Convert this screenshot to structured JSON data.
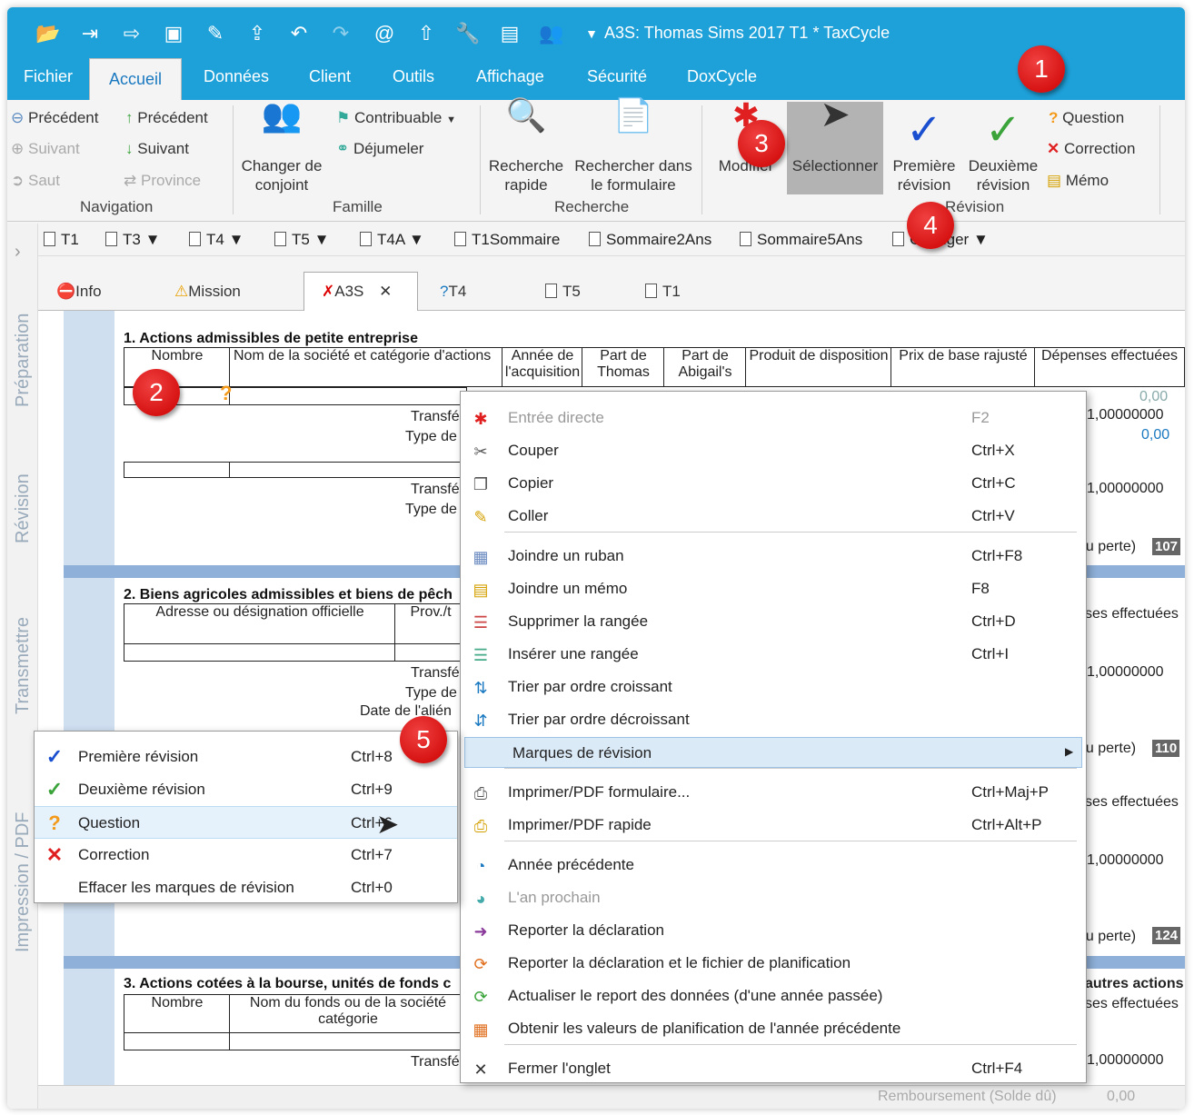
{
  "app": {
    "title": "A3S: Thomas Sims 2017 T1 * TaxCycle"
  },
  "ribbon_tabs": [
    "Fichier",
    "Accueil",
    "Données",
    "Client",
    "Outils",
    "Affichage",
    "Sécurité",
    "DoxCycle"
  ],
  "navigation": {
    "col1": [
      "Précédent",
      "Suivant",
      "Saut"
    ],
    "col2": [
      "Précédent",
      "Suivant",
      "Province"
    ],
    "group": "Navigation"
  },
  "famille": {
    "changer": "Changer de\nconjoint",
    "contribuable": "Contribuable",
    "dejumeler": "Déjumeler",
    "group": "Famille"
  },
  "recherche": {
    "rapide": "Recherche\nrapide",
    "formulaire": "Rechercher dans\nle formulaire",
    "group": "Recherche"
  },
  "revision": {
    "modifier": "Modifier",
    "selectionner": "Sélectionner",
    "premiere": "Première\nrévision",
    "deuxieme": "Deuxième\nrévision",
    "group": "Révision",
    "question": "Question",
    "correction": "Correction",
    "memo": "Mémo"
  },
  "formbar": [
    "T1",
    "T3",
    "T4",
    "T5",
    "T4A",
    "T1Sommaire",
    "Sommaire2Ans",
    "Sommaire5Ans",
    "Changer"
  ],
  "left_panels": [
    "Préparation",
    "Révision",
    "Transmettre",
    "Impression / PDF"
  ],
  "doc_tabs": [
    "Info",
    "Mission",
    "A3S",
    "T4",
    "T5",
    "T1"
  ],
  "form": {
    "s1": "1. Actions admissibles de petite entreprise",
    "s1_cols": [
      "Nombre",
      "Nom de la société et catégorie d'actions",
      "Année de l'acquisition",
      "Part de Thomas",
      "Part de Abigail's",
      "Produit de disposition",
      "Prix de base rajusté",
      "Dépenses effectuées"
    ],
    "transfer": "Transfé",
    "type": "Type de",
    "date_alien": "Date de l'alién",
    "v_zero": "0,00",
    "v_ratio": "1,00000000",
    "perte": "ou perte)",
    "n107": "107",
    "n110": "110",
    "n124": "124",
    "s2": "2. Biens agricoles admissibles et biens de pêch",
    "s2_cols": [
      "Adresse ou désignation officielle",
      "Prov./t"
    ],
    "s2_dep": "ses effectuées",
    "s3": "3. Actions cotées à la bourse, unités de fonds c",
    "s3_cols": [
      "Nombre",
      "Nom du fonds ou de la société catégorie"
    ],
    "s3_right": "autres actions",
    "status_label": "Remboursement (Solde dû)",
    "status_value": "0,00"
  },
  "context_menu": [
    {
      "label": "Entrée directe",
      "key": "F2",
      "disabled": true,
      "icon": "asterisk-icon"
    },
    {
      "label": "Couper",
      "key": "Ctrl+X",
      "icon": "scissors-icon"
    },
    {
      "label": "Copier",
      "key": "Ctrl+C",
      "icon": "copy-icon"
    },
    {
      "label": "Coller",
      "key": "Ctrl+V",
      "icon": "paste-icon"
    },
    {
      "label": "Joindre un ruban",
      "key": "Ctrl+F8",
      "icon": "tape-icon"
    },
    {
      "label": "Joindre un mémo",
      "key": "F8",
      "icon": "memo-icon"
    },
    {
      "label": "Supprimer la rangée",
      "key": "Ctrl+D",
      "icon": "delete-row-icon"
    },
    {
      "label": "Insérer une rangée",
      "key": "Ctrl+I",
      "icon": "insert-row-icon"
    },
    {
      "label": "Trier par ordre croissant",
      "key": "",
      "icon": "sort-asc-icon"
    },
    {
      "label": "Trier par ordre décroissant",
      "key": "",
      "icon": "sort-desc-icon"
    },
    {
      "label": "Marques de révision",
      "key": "",
      "icon": "",
      "submenu": true
    },
    {
      "label": "Imprimer/PDF formulaire...",
      "key": "Ctrl+Maj+P",
      "icon": "print-icon"
    },
    {
      "label": "Imprimer/PDF rapide",
      "key": "Ctrl+Alt+P",
      "icon": "quick-print-icon"
    },
    {
      "label": "Année précédente",
      "key": "",
      "icon": "prev-year-icon"
    },
    {
      "label": "L'an prochain",
      "key": "",
      "disabled": true,
      "icon": "next-year-icon"
    },
    {
      "label": "Reporter la déclaration",
      "key": "",
      "icon": "carry-forward-icon"
    },
    {
      "label": "Reporter la déclaration et le fichier de planification",
      "key": "",
      "icon": "carry-plan-icon"
    },
    {
      "label": "Actualiser le report des données (d'une année passée)",
      "key": "",
      "icon": "refresh-icon"
    },
    {
      "label": "Obtenir les valeurs de planification de l'année précédente",
      "key": "",
      "icon": "calendar-icon"
    },
    {
      "label": "Fermer l'onglet",
      "key": "Ctrl+F4",
      "icon": "close-icon"
    }
  ],
  "submenu": [
    {
      "label": "Première révision",
      "key": "Ctrl+8",
      "icon": "blue-check-icon"
    },
    {
      "label": "Deuxième révision",
      "key": "Ctrl+9",
      "icon": "green-check-icon"
    },
    {
      "label": "Question",
      "key": "Ctrl+6",
      "icon": "question-icon"
    },
    {
      "label": "Correction",
      "key": "Ctrl+7",
      "icon": "red-x-icon"
    },
    {
      "label": "Effacer les marques de révision",
      "key": "Ctrl+0",
      "icon": ""
    }
  ],
  "callouts": [
    "1",
    "2",
    "3",
    "4",
    "5"
  ],
  "colors": {
    "title_bar": "#1ea0d8",
    "callout": "#dd1111",
    "check_blue": "#1a4fd0",
    "check_green": "#3aa33a",
    "question": "#f39a1a",
    "x_red": "#e02020"
  }
}
